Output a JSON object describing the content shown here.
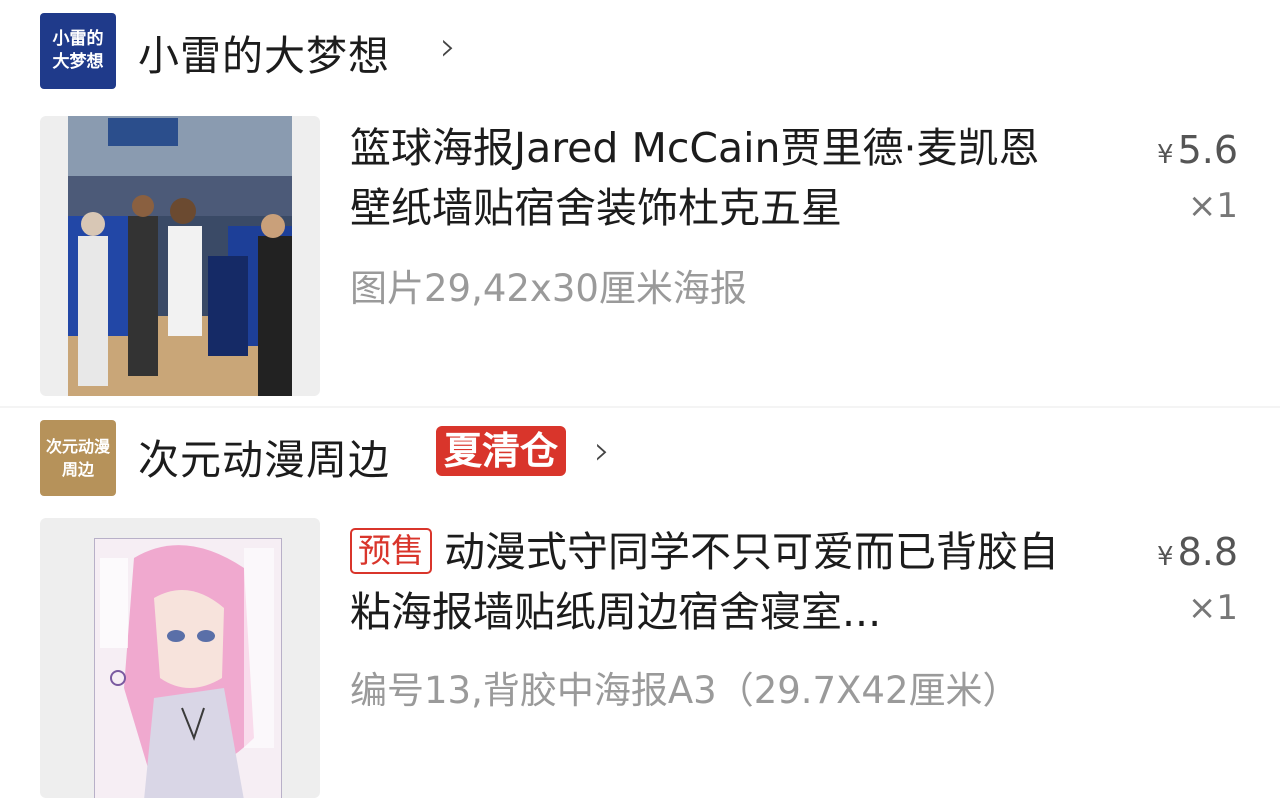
{
  "shops": [
    {
      "logo_text": "小雷的大梦想",
      "name": "小雷的大梦想",
      "chevron": "›"
    },
    {
      "logo_text": "次元动漫周边",
      "name": "次元动漫周边",
      "badge": "夏清仓",
      "chevron": "›"
    }
  ],
  "items": [
    {
      "image": "basketball-poster-photo",
      "title": "篮球海报Jared McCain贾里德·麦凯恩壁纸墙贴宿舍装饰杜克五星",
      "sku": "图片29,42x30厘米海报",
      "currency": "¥",
      "price": "5.6",
      "qty": "×1"
    },
    {
      "image": "anime-manga-cover",
      "tag": "预售",
      "title": "动漫式守同学不只可爱而已背胶自粘海报墙贴纸周边宿舍寝室...",
      "sku": "编号13,背胶中海报A3（29.7X42厘米）",
      "currency": "¥",
      "price": "8.8",
      "qty": "×1"
    }
  ],
  "colors": {
    "accent_red": "#d9352b",
    "shop1_logo": "#1f3a8a",
    "shop2_logo": "#b6925a"
  }
}
